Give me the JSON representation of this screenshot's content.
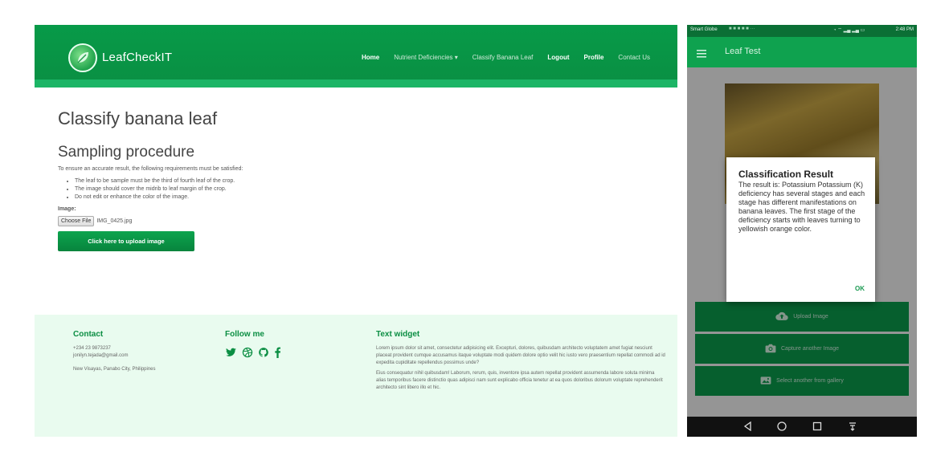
{
  "web": {
    "brand": "LeafCheckIT",
    "nav": [
      "Home",
      "Nutrient Deficiencies ▾",
      "Classify Banana Leaf",
      "Logout",
      "Profile",
      "Contact Us"
    ],
    "page_title": "Classify banana leaf",
    "section_title": "Sampling procedure",
    "intro": "To ensure an accurate result, the following requirements must be satisfied:",
    "requirements": [
      "The leaf to be sample must be the third of fourth leaf of the crop.",
      "The image should cover the midrib to leaf margin of the crop.",
      "Do not edit or enhance the color of the image."
    ],
    "image_label": "Image:",
    "choose_file_label": "Choose File",
    "file_name": "IMG_0425.jpg",
    "upload_label": "Click here to upload image",
    "footer": {
      "contact_title": "Contact",
      "phone": "+234 23 9873237",
      "email": "jonilyn.tejada@gmail.com",
      "address": "New Visayas, Panabo City, Philippines",
      "follow_title": "Follow me",
      "social_icons": [
        "twitter-icon",
        "dribbble-icon",
        "github-icon",
        "facebook-icon"
      ],
      "widget_title": "Text widget",
      "widget_p1": "Lorem ipsum dolor sit amet, consectetur adipisicing elit. Excepturi, dolores, quibusdam architecto voluptatem amet fugiat nesciunt placeat provident cumque accusamus itaque voluptate modi quidem dolore optio velit hic iusto vero praesentium repellat commodi ad id expedita cupiditate repellendus possimus unde?",
      "widget_p2": "Eius consequatur nihil quibusdam! Laborum, rerum, quis, inventore ipsa autem repellat provident assumenda labore soluta minima alias temporibus facere distinctio quas adipisci nam sunt explicabo officia tenetur at ea quos doloribus dolorum voluptate reprehenderit architecto sint libero illo et hic."
    },
    "colors": {
      "header": "#079a48",
      "accent": "#0b8e43",
      "footer_bg": "#e9fbef"
    }
  },
  "phone": {
    "status_left": "Smart Globe",
    "status_right": "2:48 PM",
    "app_title": "Leaf Test",
    "dialog": {
      "title": "Classification Result",
      "body": "The result is: Potassium Potassium (K) deficiency has several stages and each stage has different manifestations on banana leaves. The first stage of the deficiency starts with leaves turning to yellowish orange color.",
      "ok_label": "OK"
    },
    "buttons": [
      "Upload Image",
      "Capture another Image",
      "Select another from gallery"
    ]
  }
}
